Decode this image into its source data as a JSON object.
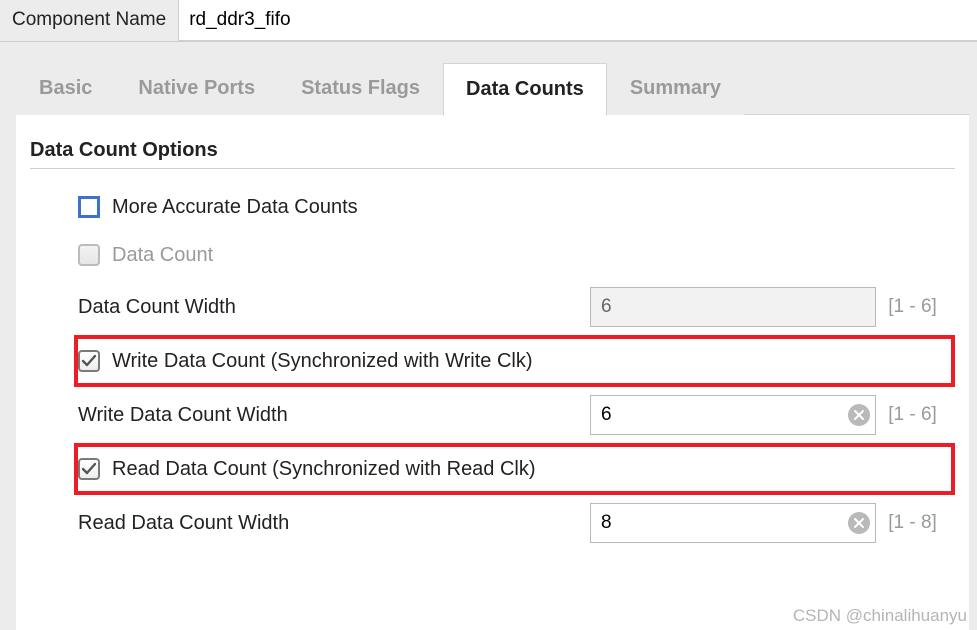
{
  "component_name": {
    "label": "Component Name",
    "value": "rd_ddr3_fifo"
  },
  "tabs": {
    "basic": "Basic",
    "native_ports": "Native Ports",
    "status_flags": "Status Flags",
    "data_counts": "Data Counts",
    "summary": "Summary",
    "active": "data_counts"
  },
  "section": {
    "title": "Data Count Options"
  },
  "options": {
    "more_accurate": {
      "label": "More Accurate Data Counts",
      "checked": false
    },
    "data_count": {
      "label": "Data Count",
      "checked": false,
      "disabled": true
    },
    "write_dc": {
      "label": "Write Data Count (Synchronized with Write Clk)",
      "checked": true
    },
    "read_dc": {
      "label": "Read Data Count (Synchronized with Read Clk)",
      "checked": true
    }
  },
  "fields": {
    "dc_width": {
      "label": "Data Count Width",
      "value": "6",
      "range": "[1 - 6]",
      "disabled": true
    },
    "write_dc_width": {
      "label": "Write Data Count Width",
      "value": "6",
      "range": "[1 - 6]"
    },
    "read_dc_width": {
      "label": "Read Data Count Width",
      "value": "8",
      "range": "[1 - 8]"
    }
  },
  "watermark": "CSDN @chinalihuanyu"
}
